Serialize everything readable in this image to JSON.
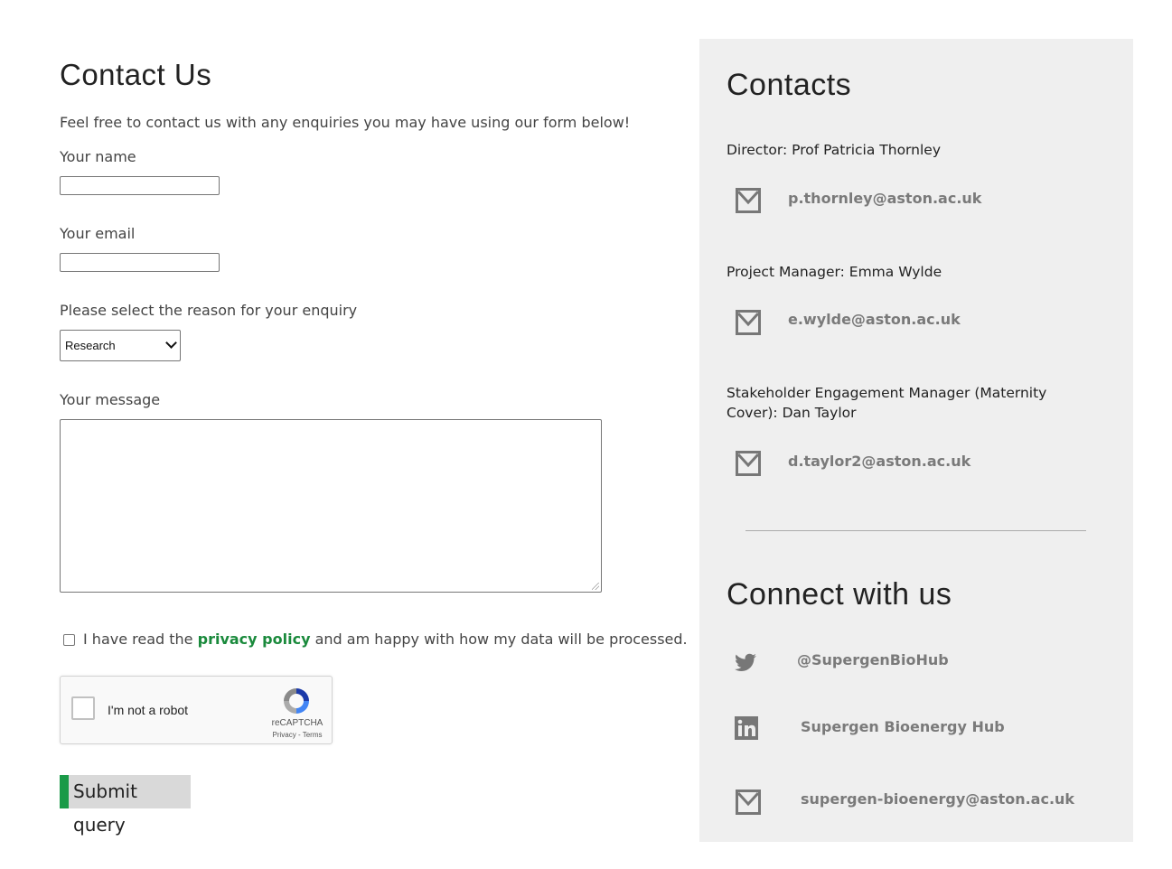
{
  "form": {
    "title": "Contact Us",
    "intro": "Feel free to contact us with any enquiries you may have using our form below!",
    "name_label": "Your name",
    "name_value": "",
    "email_label": "Your email",
    "email_value": "",
    "reason_label": "Please select the reason for your enquiry",
    "reason_selected": "Research",
    "message_label": "Your message",
    "message_value": "",
    "privacy_prefix": "I have read the",
    "privacy_link": "privacy policy",
    "privacy_suffix": "and am happy with how my data will be processed.",
    "captcha_label": "I'm not a robot",
    "captcha_brand": "reCAPTCHA",
    "captcha_terms": "Privacy - Terms",
    "submit_label": "Submit query",
    "accent_color": "#1a9a48"
  },
  "contacts": {
    "title": "Contacts",
    "people": [
      {
        "role": "Director: Prof Patricia Thornley",
        "email": "p.thornley@aston.ac.uk"
      },
      {
        "role": "Project Manager: Emma Wylde",
        "email": "e.wylde@aston.ac.uk"
      },
      {
        "role": "Stakeholder Engagement Manager (Maternity Cover): Dan Taylor",
        "email": "d.taylor2@aston.ac.uk"
      }
    ]
  },
  "connect": {
    "title": "Connect with us",
    "twitter_icon": "twitter-icon",
    "twitter": "@SupergenBioHub",
    "linkedin_icon": "linkedin-icon",
    "linkedin": "Supergen Bioenergy Hub",
    "email_icon": "mail-icon",
    "email": "supergen-bioenergy@aston.ac.uk"
  }
}
